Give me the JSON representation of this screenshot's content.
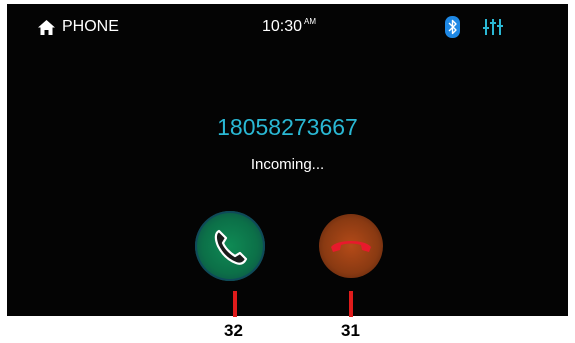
{
  "status_bar": {
    "home_label": "PHONE",
    "clock_time": "10:30",
    "clock_ampm": "AM",
    "bluetooth_icon": "bluetooth-icon",
    "settings_icon": "equalizer-sliders-icon",
    "accent_color": "#2ab8d4"
  },
  "call": {
    "number": "18058273667",
    "status": "Incoming..."
  },
  "buttons": {
    "answer_icon": "phone-answer-icon",
    "answer_color": "#0f8a54",
    "reject_icon": "phone-hangup-icon",
    "reject_color": "#b44a18"
  },
  "callouts": [
    {
      "label": "32"
    },
    {
      "label": "31"
    }
  ]
}
